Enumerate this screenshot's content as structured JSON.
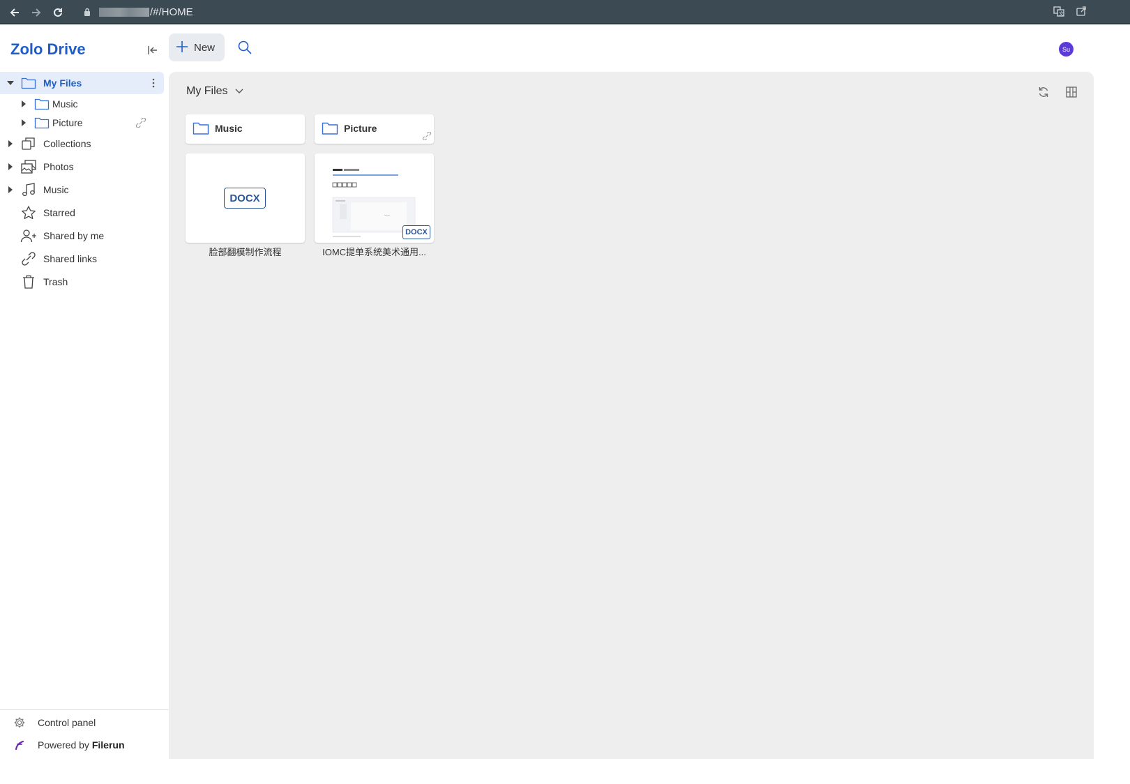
{
  "browser": {
    "url_suffix": "/#/HOME",
    "icons": [
      "back-icon",
      "forward-icon",
      "reload-icon",
      "lock-icon",
      "translate-icon",
      "share-icon"
    ]
  },
  "app": {
    "brand": "Zolo Drive",
    "new_label": "New",
    "avatar_initials": "Su"
  },
  "sidebar": {
    "items": [
      {
        "label": "My Files",
        "icon": "folder-icon"
      },
      {
        "label": "Music",
        "icon": "folder-icon"
      },
      {
        "label": "Picture",
        "icon": "folder-icon"
      },
      {
        "label": "Collections",
        "icon": "collections-icon"
      },
      {
        "label": "Photos",
        "icon": "photos-icon"
      },
      {
        "label": "Music",
        "icon": "music-icon"
      },
      {
        "label": "Starred",
        "icon": "star-icon"
      },
      {
        "label": "Shared by me",
        "icon": "add-user-icon"
      },
      {
        "label": "Shared links",
        "icon": "link-icon"
      },
      {
        "label": "Trash",
        "icon": "trash-icon"
      }
    ],
    "control_panel": "Control panel",
    "powered_prefix": "Powered by ",
    "powered_brand": "Filerun"
  },
  "main": {
    "breadcrumb": "My Files",
    "folders": [
      {
        "name": "Music"
      },
      {
        "name": "Picture"
      }
    ],
    "files": [
      {
        "name": "脸部翻模制作流程",
        "type": "DOCX"
      },
      {
        "name": "IOMC提单系统美术通用...",
        "type": "DOCX"
      }
    ]
  },
  "colors": {
    "accent": "#1f5ec9",
    "browser_bar": "#3c4a53",
    "main_bg": "#eeeeee",
    "avatar": "#5b3bd6",
    "docx": "#2a5699"
  }
}
